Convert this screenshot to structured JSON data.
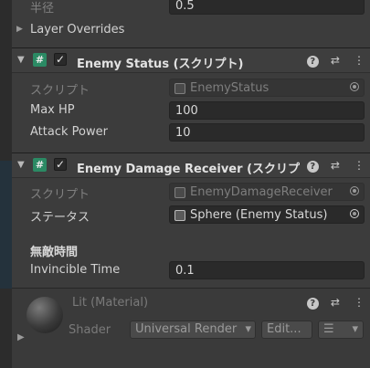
{
  "top_field": {
    "label": "半径",
    "value": "0.5"
  },
  "layer_overrides": {
    "label": "Layer Overrides"
  },
  "enemy_status": {
    "title": "Enemy Status (スクリプト)",
    "script_label": "スクリプト",
    "script_value": "EnemyStatus",
    "fields": [
      {
        "label": "Max HP",
        "value": "100"
      },
      {
        "label": "Attack Power",
        "value": "10"
      }
    ]
  },
  "enemy_damage_receiver": {
    "title": "Enemy Damage Receiver (スクリプト)",
    "script_label": "スクリプト",
    "script_value": "EnemyDamageReceiver",
    "status_label": "ステータス",
    "status_value": "Sphere (Enemy Status)",
    "section_header": "無敵時間",
    "invincible_label": "Invincible Time",
    "invincible_value": "0.1"
  },
  "material": {
    "name": "Lit (Material)",
    "shader_label": "Shader",
    "shader_value": "Universal Render",
    "edit_label": "Edit..."
  },
  "icons": {
    "script": "#",
    "check": "✓",
    "help": "?",
    "presets": "⇄",
    "menu": "⋮",
    "foldout_closed": "▶",
    "foldout_open": "▼",
    "dropdown": "▾",
    "list": "☰"
  },
  "colors": {
    "script_icon": "#2b8a64",
    "background": "#3c3c3c"
  }
}
